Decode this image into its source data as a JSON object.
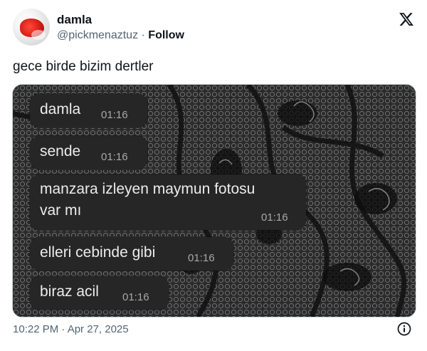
{
  "user": {
    "display_name": "damla",
    "handle": "@pickmenaztuz",
    "separator": "·",
    "follow_label": "Follow"
  },
  "tweet": {
    "text": "gece birde bizim dertler",
    "timestamp": "10:22 PM · Apr 27, 2025"
  },
  "chat_messages": [
    {
      "lines": [
        "damla"
      ],
      "time": "01:16"
    },
    {
      "lines": [
        "sende"
      ],
      "time": "01:16"
    },
    {
      "lines": [
        "manzara izleyen maymun fotosu",
        "var mı"
      ],
      "time": "01:16"
    },
    {
      "lines": [
        "elleri cebinde gibi"
      ],
      "time": "01:16"
    },
    {
      "lines": [
        "biraz acil"
      ],
      "time": "01:16"
    }
  ],
  "icons": {
    "brand": "x-logo-icon",
    "info": "info-icon",
    "avatar": "avatar"
  },
  "colors": {
    "text_primary": "#0f1419",
    "text_secondary": "#536471",
    "bubble_bg": "#262626",
    "bubble_text": "#ececec",
    "bubble_time": "#a8a8a8"
  }
}
